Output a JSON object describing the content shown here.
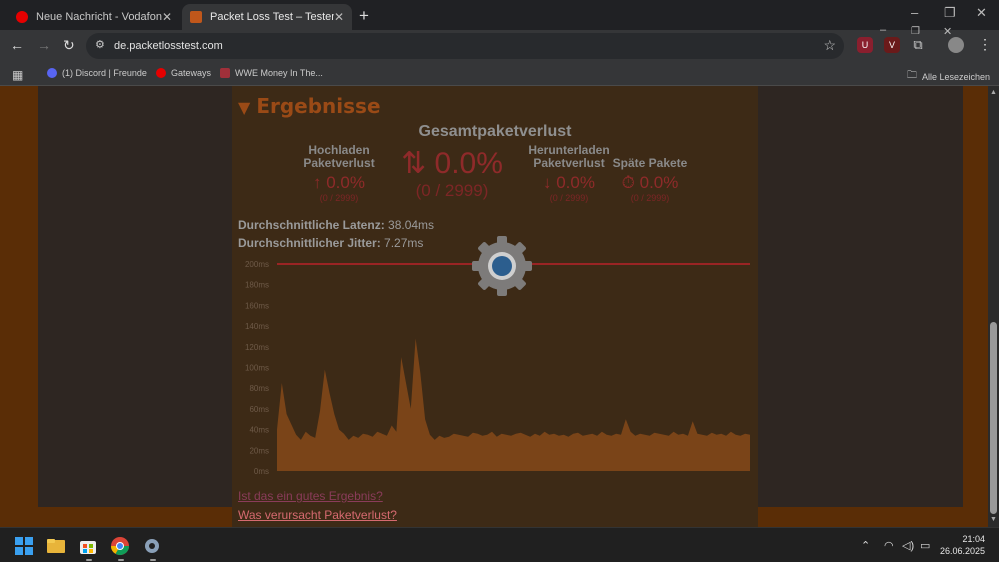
{
  "browser": {
    "tabs": [
      {
        "title": "Neue Nachricht - Vodafone Com",
        "active": false
      },
      {
        "title": "Packet Loss Test – Testen Sie Ihr",
        "active": true
      }
    ],
    "url": "de.packetlosstest.com",
    "bookmarks": [
      "(1) Discord | Freunde",
      "Gateways",
      "WWE Money In The...",
      "Alle Lesezeichen"
    ]
  },
  "results": {
    "section_title": "Ergebnisse",
    "total_title": "Gesamtpaketverlust",
    "upload": {
      "label1": "Hochladen",
      "label2": "Paketverlust",
      "value": "↑ 0.0%",
      "count": "(0 / 2999)"
    },
    "total": {
      "value": "⇅ 0.0%",
      "count": "(0 / 2999)"
    },
    "download": {
      "label1": "Herunterladen",
      "label2": "Paketverlust",
      "value": "↓ 0.0%",
      "count": "(0 / 2999)"
    },
    "late": {
      "label1": "",
      "label2": "Späte Pakete",
      "value": "⏱ 0.0%",
      "count": "(0 / 2999)"
    },
    "latency_label": "Durchschnittliche Latenz:",
    "latency_value": "38.04ms",
    "jitter_label": "Durchschnittlicher Jitter:",
    "jitter_value": "7.27ms",
    "link_good": "Ist das ein gutes Ergebnis?",
    "link_cause": "Was verursacht Paketverlust?"
  },
  "chart_data": {
    "type": "area",
    "ylabel_ticks": [
      "200ms",
      "180ms",
      "160ms",
      "140ms",
      "120ms",
      "100ms",
      "80ms",
      "60ms",
      "40ms",
      "20ms",
      "0ms"
    ],
    "ylim": [
      0,
      200
    ],
    "threshold": 200,
    "values": [
      40,
      85,
      55,
      45,
      35,
      30,
      38,
      34,
      32,
      58,
      98,
      75,
      55,
      40,
      36,
      30,
      34,
      32,
      36,
      35,
      33,
      38,
      36,
      34,
      44,
      38,
      110,
      85,
      60,
      128,
      95,
      50,
      35,
      30,
      34,
      32,
      33,
      36,
      35,
      34,
      33,
      37,
      36,
      34,
      35,
      38,
      33,
      36,
      35,
      34,
      36,
      37,
      35,
      33,
      36,
      34,
      38,
      35,
      36,
      34,
      35,
      33,
      36,
      37,
      34,
      35,
      36,
      34,
      38,
      35,
      34,
      36,
      35,
      50,
      38,
      34,
      36,
      35,
      34,
      37,
      36,
      35,
      34,
      38,
      35,
      36,
      34,
      48,
      36,
      35,
      34,
      37,
      35,
      36,
      34,
      38,
      35,
      34,
      36,
      35
    ]
  },
  "taskbar": {
    "time": "21:04",
    "date": "26.06.2025"
  },
  "colors": {
    "accent": "#9a4a16",
    "loss": "#8f2a2a",
    "area": "#7a4418",
    "threshold": "#9a2424"
  }
}
